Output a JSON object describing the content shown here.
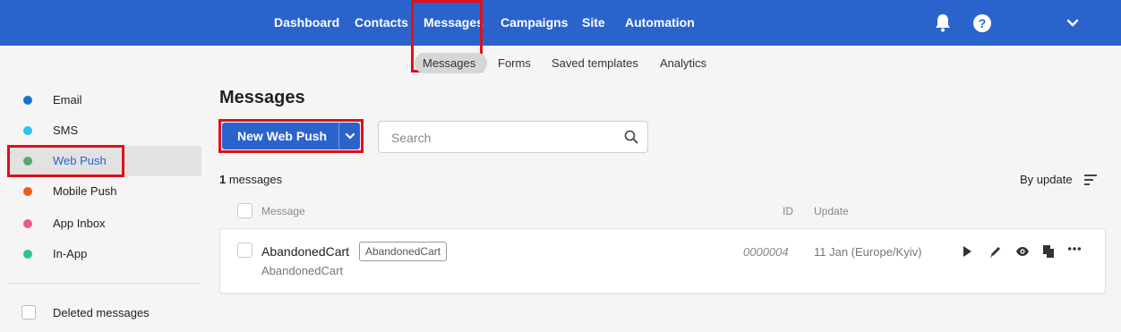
{
  "topnav": {
    "items": [
      "Dashboard",
      "Contacts",
      "Messages",
      "Campaigns",
      "Site",
      "Automation"
    ],
    "active": "Messages",
    "icons": [
      "bell-icon",
      "help-icon",
      "chevron-down-icon"
    ],
    "help_glyph": "?"
  },
  "subnav": {
    "items": [
      "Messages",
      "Forms",
      "Saved templates",
      "Analytics"
    ],
    "active": "Messages"
  },
  "sidebar": {
    "items": [
      {
        "label": "Email",
        "color": "#1a73c9"
      },
      {
        "label": "SMS",
        "color": "#2ec0f0"
      },
      {
        "label": "Web Push",
        "color": "#5aa86a",
        "active": true
      },
      {
        "label": "Mobile Push",
        "color": "#f05a1a"
      },
      {
        "label": "App Inbox",
        "color": "#f05a8a"
      },
      {
        "label": "In-App",
        "color": "#2cc29a"
      }
    ],
    "deleted_label": "Deleted messages"
  },
  "main": {
    "title": "Messages",
    "new_button_label": "New Web Push",
    "search_placeholder": "Search",
    "count_number": "1",
    "count_suffix": " messages",
    "sort_label": "By update",
    "columns": {
      "message": "Message",
      "id": "ID",
      "update": "Update"
    },
    "rows": [
      {
        "name": "AbandonedCart",
        "tag": "AbandonedCart",
        "subtitle": "AbandonedCart",
        "id": "0000004",
        "update": "11 Jan (Europe/Kyiv)"
      }
    ],
    "row_actions": [
      "play-icon",
      "edit-icon",
      "view-icon",
      "copy-icon",
      "more-icon"
    ]
  },
  "colors": {
    "accent": "#2b63cc",
    "highlight": "#e0101a",
    "active_link": "#2b63cc"
  }
}
